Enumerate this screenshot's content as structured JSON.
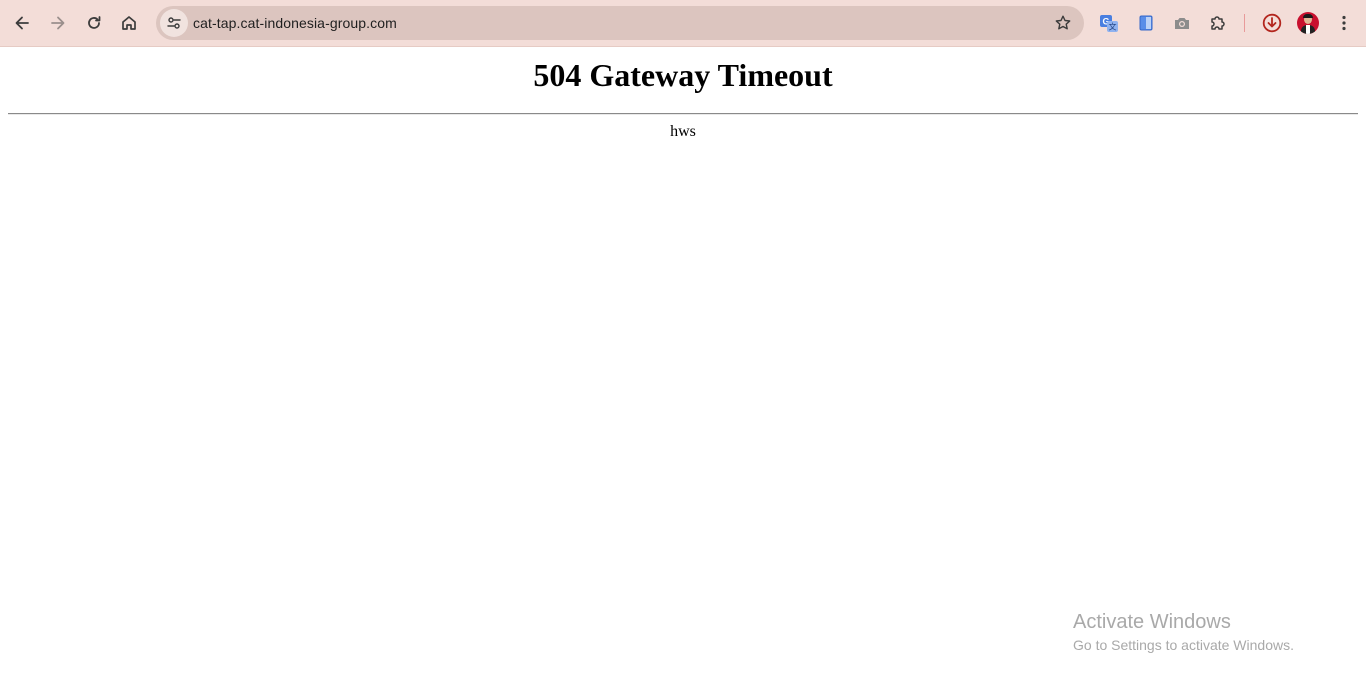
{
  "browser": {
    "address_bar": {
      "url": "cat-tap.cat-indonesia-group.com"
    },
    "nav_icons": [
      "back-icon",
      "forward-icon",
      "reload-icon",
      "home-icon"
    ],
    "toolbar_icons": [
      "site-info-icon",
      "bookmark-star-icon",
      "translate-icon",
      "sidebar-panel-icon",
      "camera-icon",
      "extensions-puzzle-icon",
      "download-icon",
      "profile-avatar",
      "more-menu-icon"
    ],
    "colors": {
      "toolbar_bg": "#f3ddd8",
      "omnibox_bg": "#dcc5bf",
      "accent_red": "#c8102e"
    }
  },
  "page": {
    "heading": "504 Gateway Timeout",
    "server_text": "hws"
  },
  "watermark": {
    "title": "Activate Windows",
    "subtitle": "Go to Settings to activate Windows."
  }
}
